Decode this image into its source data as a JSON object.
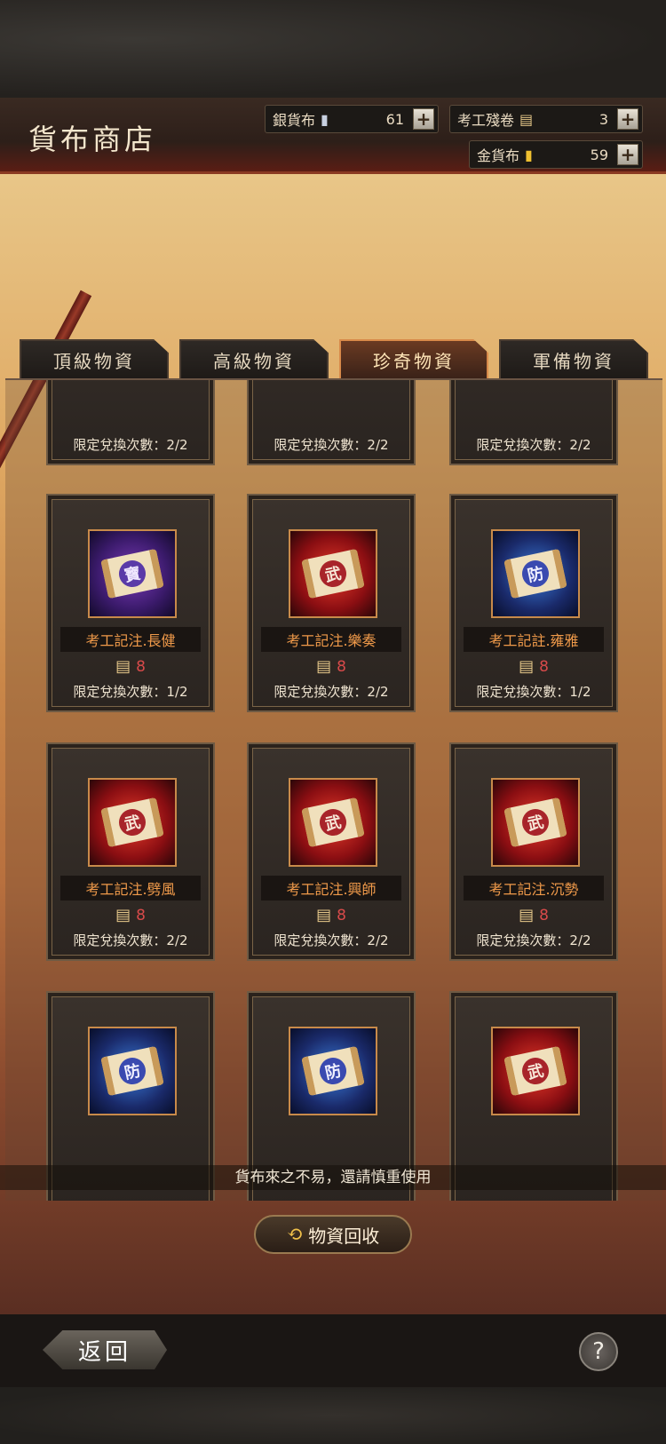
{
  "header": {
    "title": "貨布商店",
    "currencies": [
      {
        "label": "銀貨布",
        "icon": "silver-coin-icon",
        "value": "61"
      },
      {
        "label": "考工殘卷",
        "icon": "scroll-fragment-icon",
        "value": "3"
      },
      {
        "label": "金貨布",
        "icon": "gold-coin-icon",
        "value": "59"
      }
    ],
    "plus_label": "+"
  },
  "tabs": [
    {
      "label": "頂級物資",
      "active": false
    },
    {
      "label": "高級物資",
      "active": false
    },
    {
      "label": "珍奇物資",
      "active": true
    },
    {
      "label": "軍備物資",
      "active": false
    }
  ],
  "partial_row": [
    {
      "limit": "限定兌換次數：2/2"
    },
    {
      "limit": "限定兌換次數：2/2"
    },
    {
      "limit": "限定兌換次數：2/2"
    }
  ],
  "items": [
    {
      "name": "考工記注.長健",
      "glyph": "寶",
      "theme": "purple",
      "price": "8",
      "limit": "限定兌換次數：1/2"
    },
    {
      "name": "考工記注.樂奏",
      "glyph": "武",
      "theme": "red",
      "price": "8",
      "limit": "限定兌換次數：2/2"
    },
    {
      "name": "考工記註.雍雅",
      "glyph": "防",
      "theme": "blue",
      "price": "8",
      "limit": "限定兌換次數：1/2"
    },
    {
      "name": "考工記注.劈風",
      "glyph": "武",
      "theme": "red",
      "price": "8",
      "limit": "限定兌換次數：2/2"
    },
    {
      "name": "考工記注.興師",
      "glyph": "武",
      "theme": "red",
      "price": "8",
      "limit": "限定兌換次數：2/2"
    },
    {
      "name": "考工記注.沉勢",
      "glyph": "武",
      "theme": "red",
      "price": "8",
      "limit": "限定兌換次數：2/2"
    },
    {
      "glyph": "防",
      "theme": "blue"
    },
    {
      "glyph": "防",
      "theme": "blue"
    },
    {
      "glyph": "武",
      "theme": "red"
    }
  ],
  "notice": "貨布來之不易，還請慎重使用",
  "recycle_label": "物資回收",
  "back_label": "返回",
  "help_label": "?",
  "colors": {
    "accent": "#f09a4a",
    "price": "#d84a4a",
    "tab_active_border": "#d88a4a"
  }
}
